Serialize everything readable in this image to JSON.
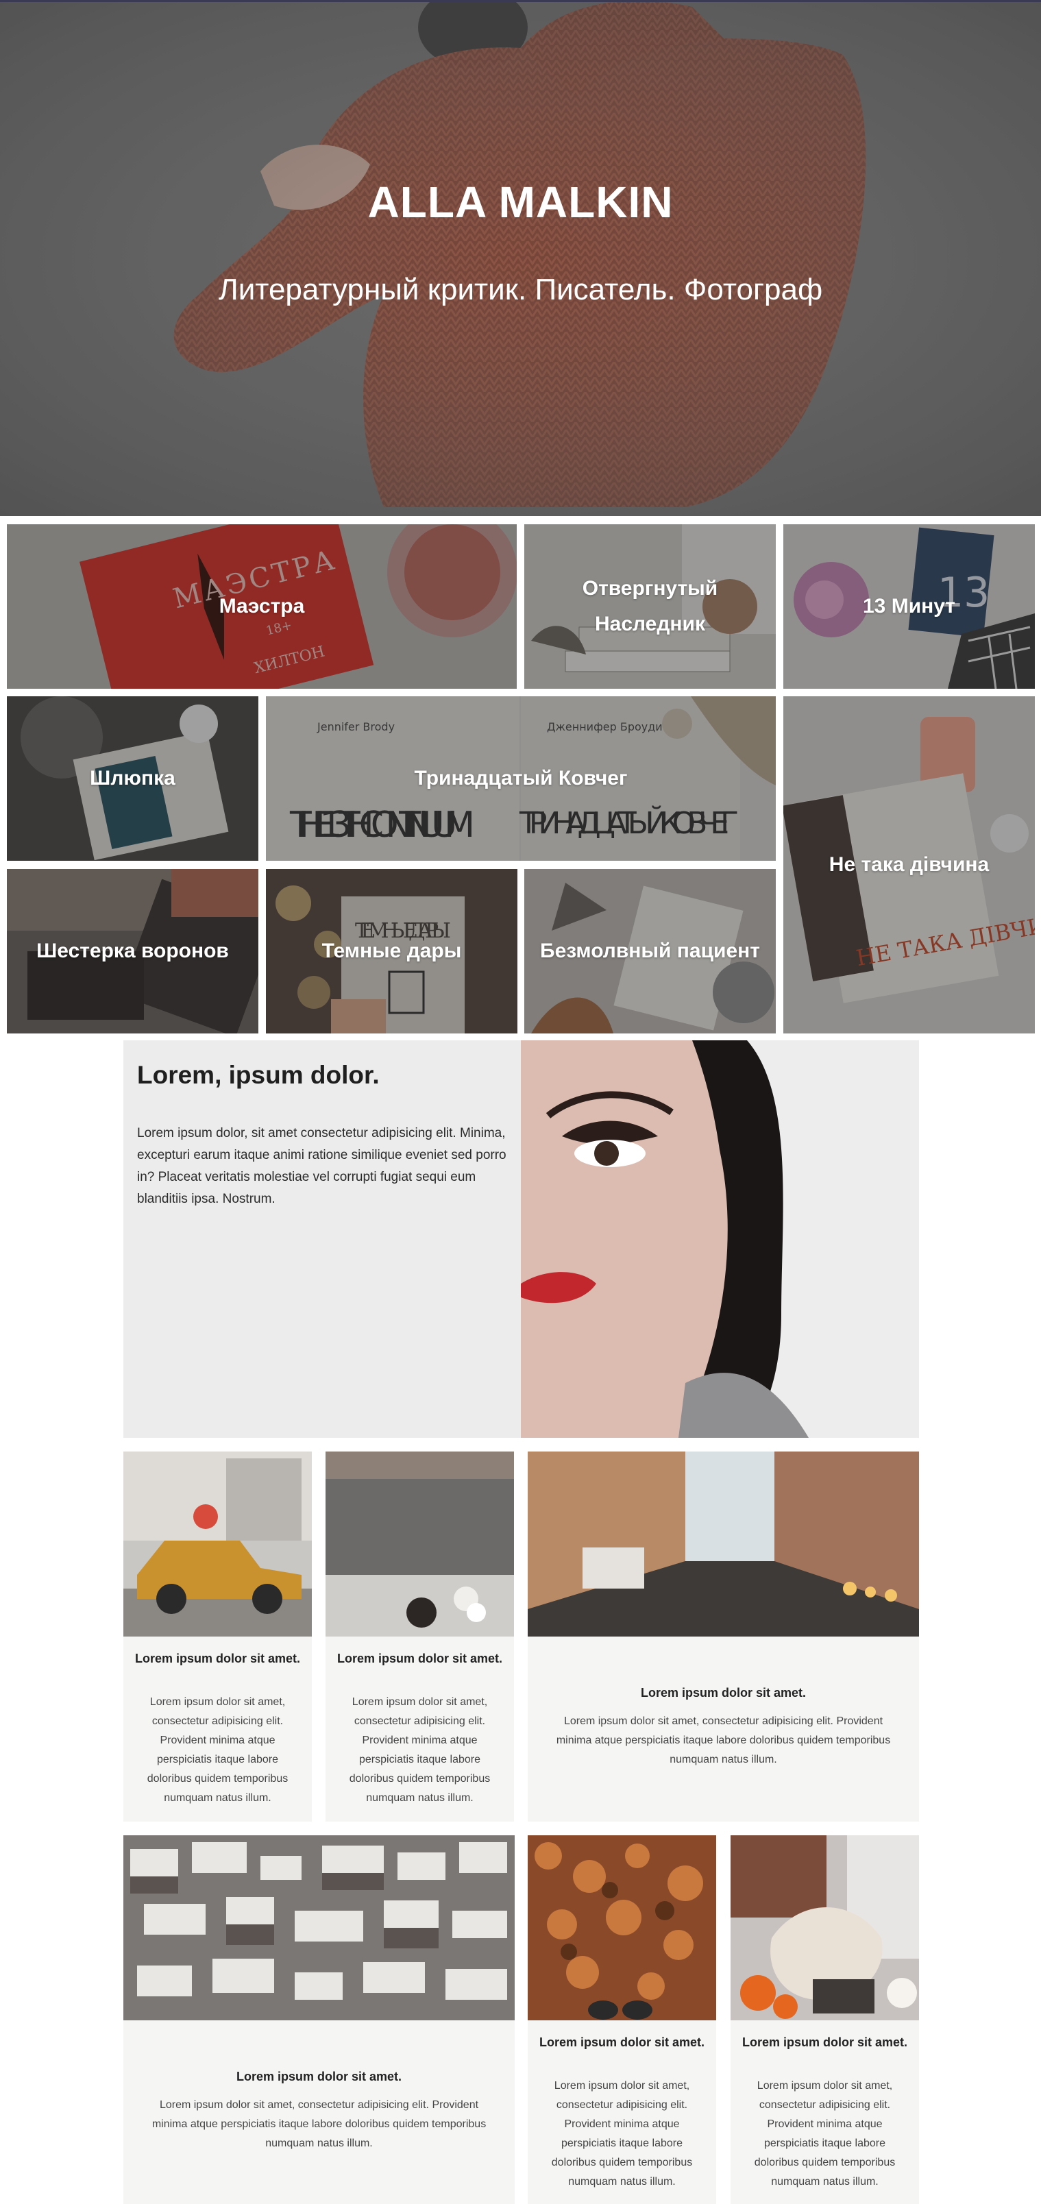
{
  "hero": {
    "title": "ALLA MALKIN",
    "subtitle": "Литературный критик. Писатель. Фотограф"
  },
  "books": [
    {
      "label": "Маэстра"
    },
    {
      "label": "Отвергнутый Наследник"
    },
    {
      "label": "13 Минут"
    },
    {
      "label": "Шлюпка"
    },
    {
      "label": "Тринадцатый Ковчег"
    },
    {
      "label": "Не така дівчина"
    },
    {
      "label": "Шестерка воронов"
    },
    {
      "label": "Темные дары"
    },
    {
      "label": "Безмолвный пациент"
    }
  ],
  "book_cover_text": {
    "maestra": "МАЭСТРА",
    "maestra_age": "18+",
    "maestra_author": "ХИЛТОН",
    "ark_author_en": "Jennifer Brody",
    "ark_author_ru": "Дженнифер Броуди",
    "ark_title_en": "THE 13TH CONTINUUM",
    "ark_title_ru": "ТРИНАДЦАТЫЙ КОВЧЕГ",
    "dark_gifts": "ТЕМНЫЕ ДАРЫ",
    "thirteen": "13",
    "girl_title": "НЕ ТАКА ДІВЧИНА"
  },
  "about": {
    "heading": "Lorem, ipsum dolor.",
    "text": "Lorem ipsum dolor, sit amet consectetur adipisicing elit. Minima, excepturi earum itaque animi ratione similique eveniet sed porro in? Placeat veritatis molestiae vel corrupti fugiat sequi eum blanditiis ipsa. Nostrum."
  },
  "cards": [
    {
      "title": "Lorem ipsum dolor sit amet.",
      "text": "Lorem ipsum dolor sit amet, consectetur adipisicing elit. Provident minima atque perspiciatis itaque labore doloribus quidem temporibus numquam natus illum."
    },
    {
      "title": "Lorem ipsum dolor sit amet.",
      "text": "Lorem ipsum dolor sit amet, consectetur adipisicing elit. Provident minima atque perspiciatis itaque labore doloribus quidem temporibus numquam natus illum."
    },
    {
      "title": "Lorem ipsum dolor sit amet.",
      "text": "Lorem ipsum dolor sit amet, consectetur adipisicing elit. Provident minima atque perspiciatis itaque labore doloribus quidem temporibus numquam natus illum."
    },
    {
      "title": "Lorem ipsum dolor sit amet.",
      "text": "Lorem ipsum dolor sit amet, consectetur adipisicing elit. Provident minima atque perspiciatis itaque labore doloribus quidem temporibus numquam natus illum."
    },
    {
      "title": "Lorem ipsum dolor sit amet.",
      "text": "Lorem ipsum dolor sit amet, consectetur adipisicing elit. Provident minima atque perspiciatis itaque labore doloribus quidem temporibus numquam natus illum."
    },
    {
      "title": "Lorem ipsum dolor sit amet.",
      "text": "Lorem ipsum dolor sit amet, consectetur adipisicing elit. Provident minima atque perspiciatis itaque labore doloribus quidem temporibus numquam natus illum."
    }
  ],
  "colors": {
    "card_bg": "#f5f5f4",
    "about_bg": "#ececec",
    "accent_red": "#d8322b"
  }
}
